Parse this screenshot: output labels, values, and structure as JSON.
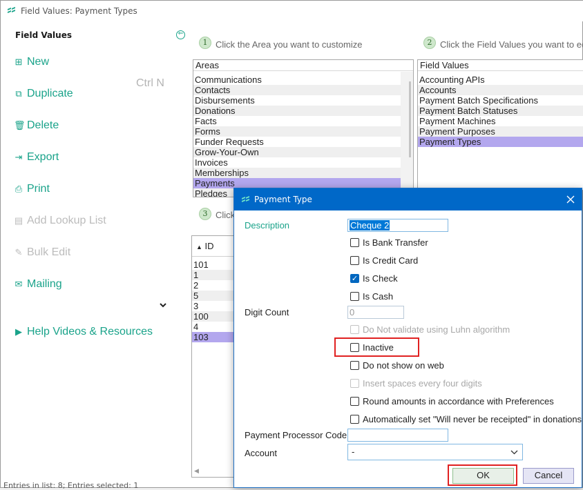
{
  "window": {
    "title": "Field Values: Payment Types"
  },
  "sidebar": {
    "title": "Field Values",
    "items": [
      {
        "label": "New",
        "icon": "plus-square-icon",
        "glyph": "⊞",
        "shortcut": "Ctrl N",
        "enabled": true
      },
      {
        "label": "Duplicate",
        "icon": "duplicate-icon",
        "glyph": "⧉",
        "enabled": true
      },
      {
        "label": "Delete",
        "icon": "trash-icon",
        "glyph": "🗑",
        "enabled": true
      },
      {
        "label": "Export",
        "icon": "export-icon",
        "glyph": "⇥",
        "enabled": true
      },
      {
        "label": "Print",
        "icon": "printer-icon",
        "glyph": "⎙",
        "enabled": true
      },
      {
        "label": "Add Lookup List",
        "icon": "lookup-list-icon",
        "glyph": "▤",
        "enabled": false
      },
      {
        "label": "Bulk Edit",
        "icon": "bulk-edit-icon",
        "glyph": "✎",
        "enabled": false
      },
      {
        "label": "Mailing",
        "icon": "mailing-icon",
        "glyph": "✉",
        "enabled": true
      },
      {
        "label": "Help Videos & Resources",
        "icon": "video-icon",
        "glyph": "▶",
        "enabled": true
      }
    ]
  },
  "steps": {
    "step1": {
      "num": "1",
      "text": "Click the Area you want to customize"
    },
    "step2": {
      "num": "2",
      "text": "Click the Field Values you want to edit"
    },
    "step3": {
      "num": "3",
      "text": "Click"
    }
  },
  "areas": {
    "header": "Areas",
    "items": [
      "Communications",
      "Contacts",
      "Disbursements",
      "Donations",
      "Facts",
      "Forms",
      "Funder Requests",
      "Grow-Your-Own",
      "Invoices",
      "Memberships",
      "Payments",
      "Pledges"
    ],
    "selected": "Payments"
  },
  "field_values": {
    "header": "Field Values",
    "items": [
      "Accounting APIs",
      "Accounts",
      "Payment Batch Specifications",
      "Payment Batch Statuses",
      "Payment Machines",
      "Payment Purposes",
      "Payment Types"
    ],
    "selected": "Payment Types"
  },
  "ids": {
    "header": "ID",
    "sort_glyph": "▲",
    "items": [
      "101",
      "1",
      "2",
      "5",
      "3",
      "100",
      "4",
      "103"
    ],
    "selected": "103"
  },
  "status": "Entries in list: 8; Entries selected: 1",
  "dialog": {
    "title": "Payment Type",
    "description_label": "Description",
    "description_value": "Cheque 2",
    "checkboxes_top": [
      {
        "label": "Is Bank Transfer",
        "checked": false
      },
      {
        "label": "Is Credit Card",
        "checked": false
      },
      {
        "label": "Is Check",
        "checked": true
      },
      {
        "label": "Is Cash",
        "checked": false
      }
    ],
    "digit_count_label": "Digit Count",
    "digit_count_value": "0",
    "checkboxes_bottom": [
      {
        "label": "Do Not validate using Luhn algorithm",
        "checked": false,
        "disabled": true
      },
      {
        "label": "Inactive",
        "checked": false,
        "disabled": false
      },
      {
        "label": "Do not show on web",
        "checked": false,
        "disabled": false
      },
      {
        "label": "Insert spaces every four digits",
        "checked": false,
        "disabled": true
      },
      {
        "label": "Round amounts in accordance with Preferences",
        "checked": false,
        "disabled": false
      },
      {
        "label": "Automatically set \"Will never be receipted\" in donations",
        "checked": false,
        "disabled": false
      }
    ],
    "processor_label": "Payment Processor Code",
    "processor_value": "",
    "account_label": "Account",
    "account_value": "-",
    "ok_label": "OK",
    "cancel_label": "Cancel"
  },
  "colors": {
    "accent": "#1aa38a",
    "dialog_title": "#0068c8",
    "selection": "#b3a7ee",
    "highlight": "#e02020"
  }
}
